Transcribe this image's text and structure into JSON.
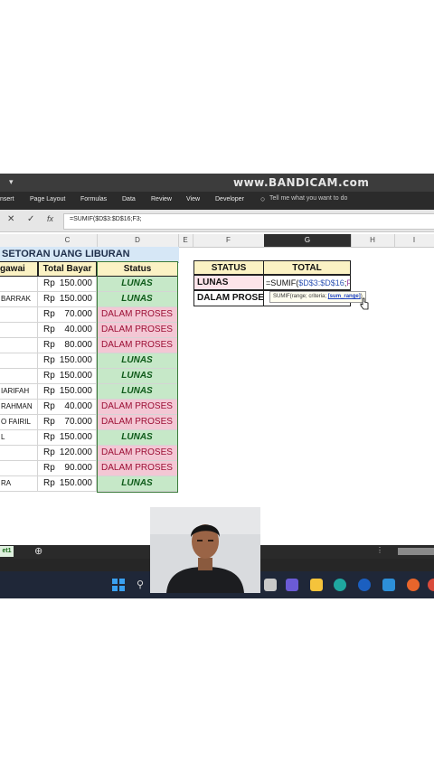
{
  "app": {
    "watermark": "www.BANDICAM.com",
    "quick_access_icon": "pin-icon"
  },
  "ribbon": {
    "tabs": [
      "nsert",
      "Page Layout",
      "Formulas",
      "Data",
      "Review",
      "View",
      "Developer"
    ],
    "tell_me": "Tell me what you want to do",
    "tell_me_icon": "lightbulb-icon"
  },
  "formula_bar": {
    "cancel_icon": "close-icon",
    "enter_icon": "check-icon",
    "fx_label": "fx",
    "content": "=SUMIF($D$3:$D$16;F3;"
  },
  "columns": [
    "C",
    "D",
    "E",
    "F",
    "G",
    "H",
    "I"
  ],
  "sheet": {
    "title": "SETORAN UANG LIBURAN",
    "headers": {
      "name": "gawai",
      "total": "Total Bayar",
      "status": "Status"
    },
    "currency": "Rp",
    "rows": [
      {
        "name": "",
        "amount": "150.000",
        "status": "LUNAS"
      },
      {
        "name": "BARRAK",
        "amount": "150.000",
        "status": "LUNAS"
      },
      {
        "name": "",
        "amount": "70.000",
        "status": "DALAM PROSES"
      },
      {
        "name": "",
        "amount": "40.000",
        "status": "DALAM PROSES"
      },
      {
        "name": "",
        "amount": "80.000",
        "status": "DALAM PROSES"
      },
      {
        "name": "",
        "amount": "150.000",
        "status": "LUNAS"
      },
      {
        "name": "",
        "amount": "150.000",
        "status": "LUNAS"
      },
      {
        "name": "IARIFAH",
        "amount": "150.000",
        "status": "LUNAS"
      },
      {
        "name": "RAHMAN",
        "amount": "40.000",
        "status": "DALAM PROSES"
      },
      {
        "name": "O FAIRIL",
        "amount": "70.000",
        "status": "DALAM PROSES"
      },
      {
        "name": "L",
        "amount": "150.000",
        "status": "LUNAS"
      },
      {
        "name": "",
        "amount": "120.000",
        "status": "DALAM PROSES"
      },
      {
        "name": "",
        "amount": "90.000",
        "status": "DALAM PROSES"
      },
      {
        "name": "RA",
        "amount": "150.000",
        "status": "LUNAS"
      }
    ]
  },
  "summary": {
    "header_status": "STATUS",
    "header_total": "TOTAL",
    "row1_label": "LUNAS",
    "row1_formula": {
      "prefix": "=SUMIF(",
      "range": "$D$3:$D$16",
      "sep": ";",
      "criteria": "F3",
      "suffix": ";"
    },
    "row2_label": "DALAM PROSES",
    "tooltip": {
      "text": "SUMIF(range; criteria; ",
      "active": "[sum_range]",
      "close": ")"
    }
  },
  "sheet_tabs": {
    "active": "et1",
    "add_icon": "plus-circle-icon"
  },
  "colors": {
    "lunas_fill": "#c6e8c8",
    "lunas_text": "#0e5a19",
    "proses_fill": "#f3c7d4",
    "proses_text": "#9c0f35",
    "header_fill": "#fbf2c4",
    "title_fill": "#d6e7f6",
    "range_ref": "#2f55b5",
    "criteria_ref": "#9b3fa0"
  },
  "taskbar_icons": [
    "windows-start-icon",
    "search-icon",
    "file-explorer-icon",
    "teams-icon",
    "folder-icon",
    "edge-icon",
    "hp-icon",
    "mail-icon",
    "firefox-icon",
    "chrome-icon"
  ]
}
